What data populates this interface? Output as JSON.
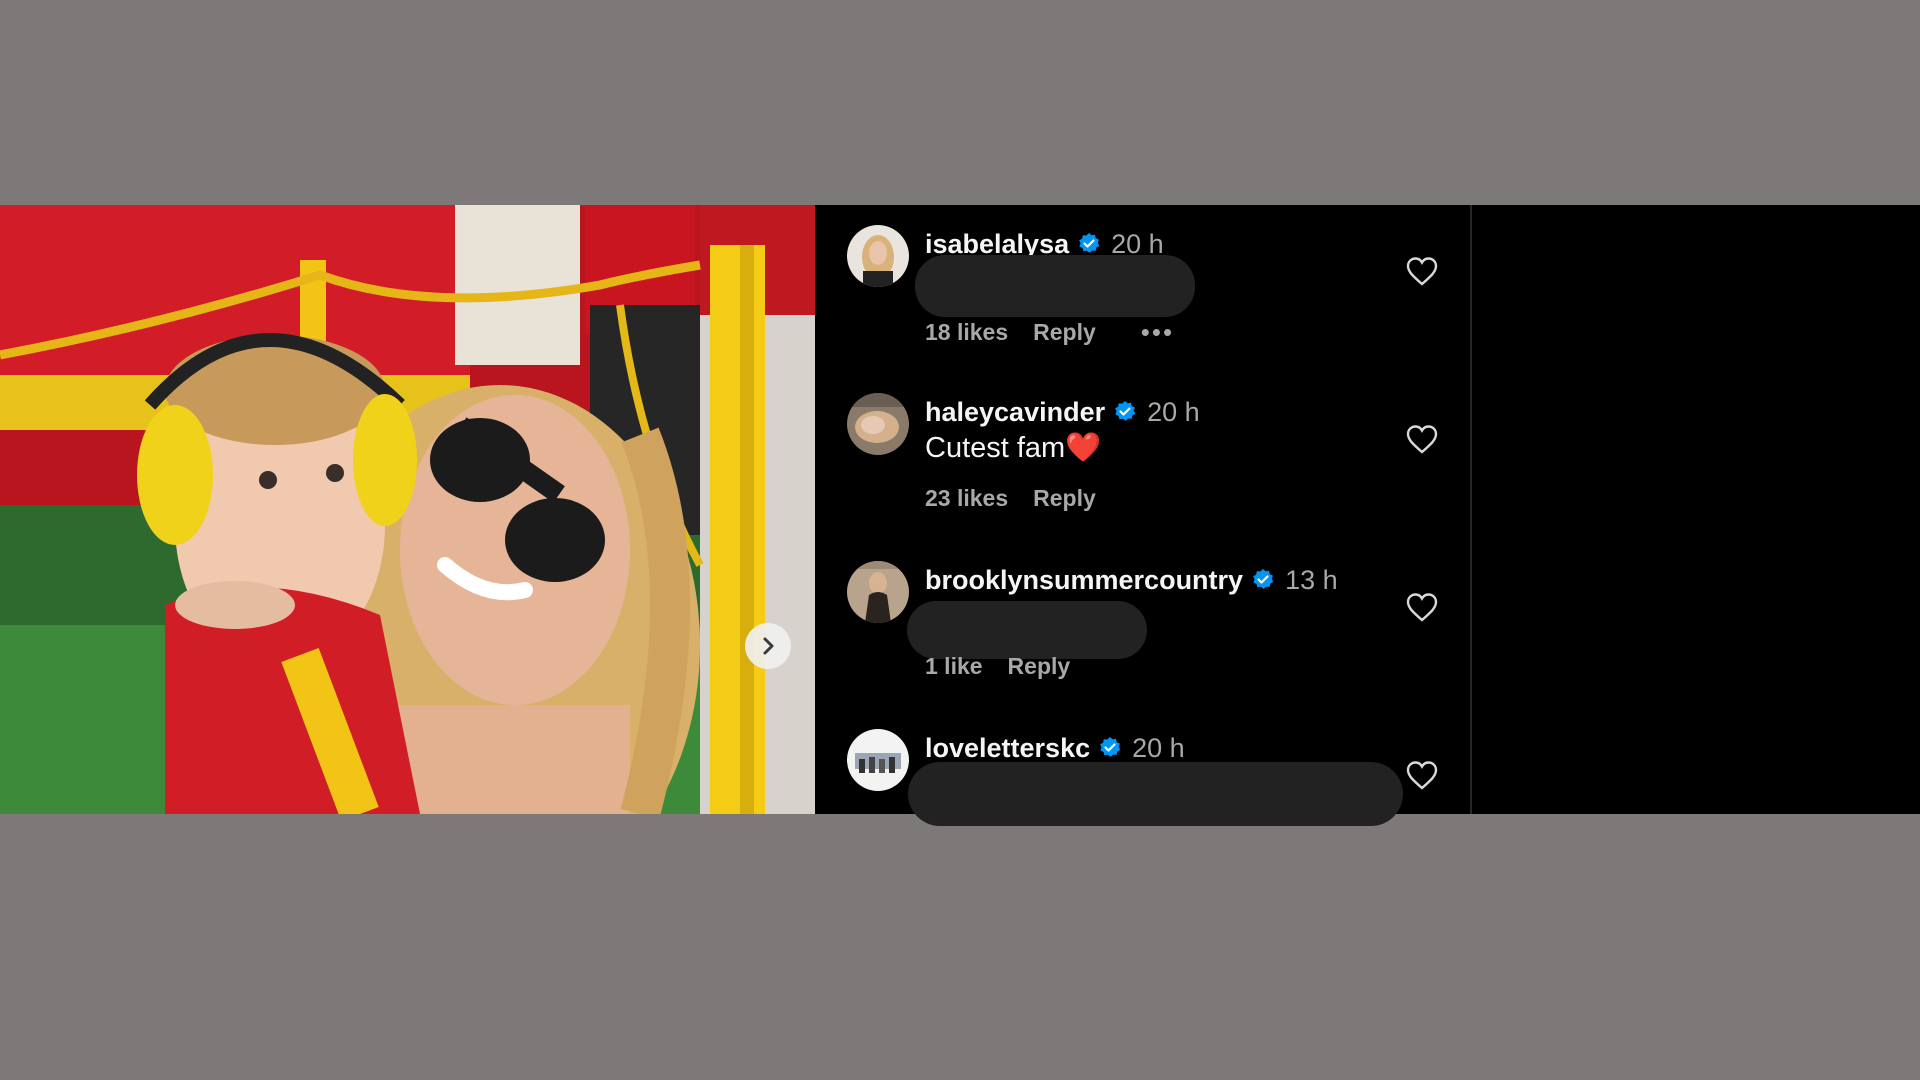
{
  "post": {
    "image_alt": "Child wearing yellow ear protectors with woman in sunglasses at stadium",
    "next_icon": "chevron-right-icon"
  },
  "comments": [
    {
      "username": "isabelalysa",
      "verified": true,
      "time": "20 h",
      "text": "",
      "likes": "18 likes",
      "reply": "Reply",
      "more": "•••",
      "redacted": true
    },
    {
      "username": "haleycavinder",
      "verified": true,
      "time": "20 h",
      "text": "Cutest fam❤️",
      "likes": "23 likes",
      "reply": "Reply",
      "more": "",
      "redacted": false
    },
    {
      "username": "brooklynsummercountry",
      "verified": true,
      "time": "13 h",
      "text": "",
      "likes": "1 like",
      "reply": "Reply",
      "more": "",
      "redacted": true
    },
    {
      "username": "loveletterskc",
      "verified": true,
      "time": "20 h",
      "text": "",
      "likes": "",
      "reply": "",
      "more": "",
      "redacted": true
    }
  ],
  "colors": {
    "background": "#7e7979",
    "panel": "#000000",
    "verified_badge": "#0095f6",
    "secondary_text": "#a8a8a8",
    "primary_text": "#f5f5f5"
  }
}
